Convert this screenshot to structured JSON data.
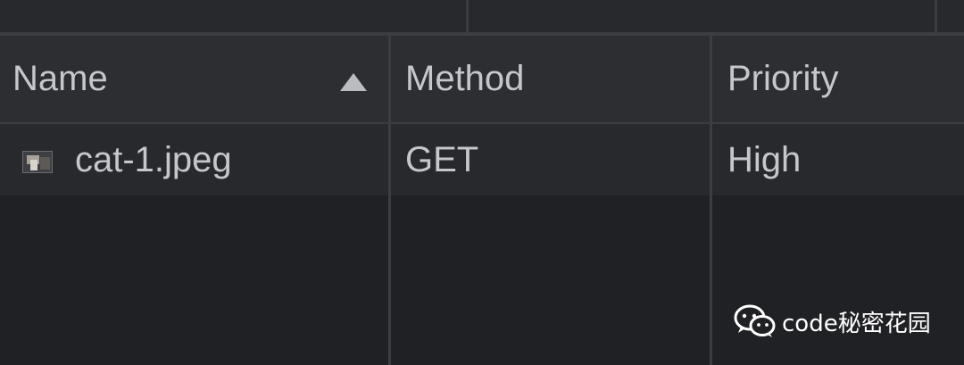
{
  "table": {
    "columns": [
      {
        "label": "Name",
        "sorted": "ascending"
      },
      {
        "label": "Method"
      },
      {
        "label": "Priority"
      }
    ],
    "rows": [
      {
        "name": "cat-1.jpeg",
        "method": "GET",
        "priority": "High",
        "icon": "image-file-icon"
      }
    ]
  },
  "watermark": {
    "text": "code秘密花园",
    "icon": "wechat-icon"
  },
  "colors": {
    "background": "#202124",
    "header_background": "#2d2e31",
    "row_background": "#28292c",
    "divider": "#3c3d40",
    "text": "#c4c7cc"
  }
}
